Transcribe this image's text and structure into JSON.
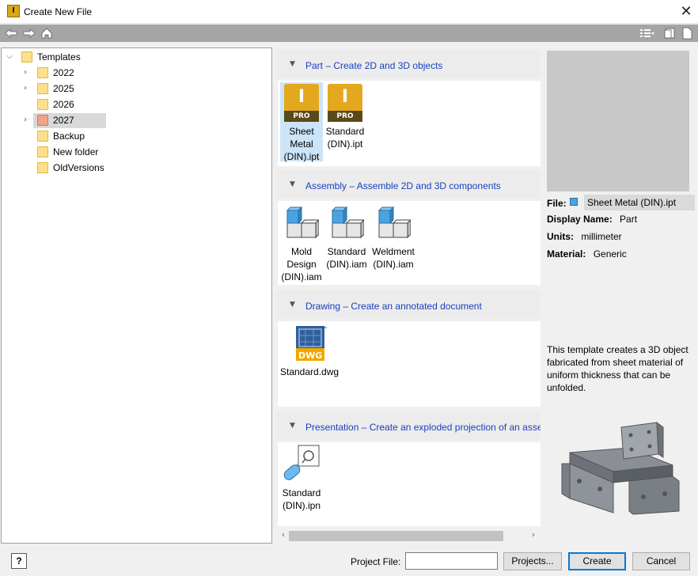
{
  "window": {
    "title": "Create New File",
    "icon_letter": "I",
    "close_glyph": "✕"
  },
  "toolbar": {
    "left_icons": [
      "back-icon",
      "forward-icon",
      "home-icon"
    ],
    "right_icons": [
      "view-options-icon",
      "small-icons-icon",
      "large-icons-icon"
    ]
  },
  "tree": {
    "root": "Templates",
    "items": [
      {
        "label": "2022",
        "expandable": true
      },
      {
        "label": "2025",
        "expandable": true
      },
      {
        "label": "2026",
        "expandable": false
      },
      {
        "label": "2027",
        "expandable": true,
        "selected": true
      },
      {
        "label": "Backup",
        "expandable": false
      },
      {
        "label": "New folder",
        "expandable": false
      },
      {
        "label": "OldVersions",
        "expandable": false
      }
    ]
  },
  "groups": [
    {
      "title": "Part – Create 2D and 3D objects",
      "items": [
        {
          "label": "Sheet\nMetal\n(DIN).ipt",
          "icon": "part-pro-icon",
          "selected": true
        },
        {
          "label": "Standard\n(DIN).ipt",
          "icon": "part-pro-icon"
        }
      ]
    },
    {
      "title": "Assembly – Assemble 2D and 3D components",
      "items": [
        {
          "label": "Mold\nDesign\n(DIN).iam",
          "icon": "assembly-icon"
        },
        {
          "label": "Standard\n(DIN).iam",
          "icon": "assembly-icon"
        },
        {
          "label": "Weldment\n(DIN).iam",
          "icon": "assembly-icon"
        }
      ]
    },
    {
      "title": "Drawing – Create an annotated document",
      "items": [
        {
          "label": "Standard.dwg",
          "icon": "dwg-icon"
        }
      ]
    },
    {
      "title": "Presentation – Create an exploded projection of an asser",
      "items": [
        {
          "label": "Standard\n(DIN).ipn",
          "icon": "presentation-icon"
        }
      ]
    }
  ],
  "icon_text": {
    "pro_letter": "I",
    "pro_badge": "PRO",
    "dwg_badge": "DWG",
    "tm": "™"
  },
  "details": {
    "file_label": "File:",
    "file_value": "Sheet Metal (DIN).ipt",
    "display_name_label": "Display Name:",
    "display_name_value": "Part",
    "units_label": "Units:",
    "units_value": "millimeter",
    "material_label": "Material:",
    "material_value": "Generic",
    "description": "This template creates a 3D object fabricated from sheet material of uniform thickness that can be unfolded."
  },
  "footer": {
    "help_label": "?",
    "project_file_label": "Project File:",
    "project_file_value": "",
    "projects_button": "Projects...",
    "create_button": "Create",
    "cancel_button": "Cancel"
  },
  "colors": {
    "accent": "#0078d7",
    "link": "#1a3fbf",
    "pro_gold": "#e3a81e",
    "selection": "#cce4f7"
  }
}
